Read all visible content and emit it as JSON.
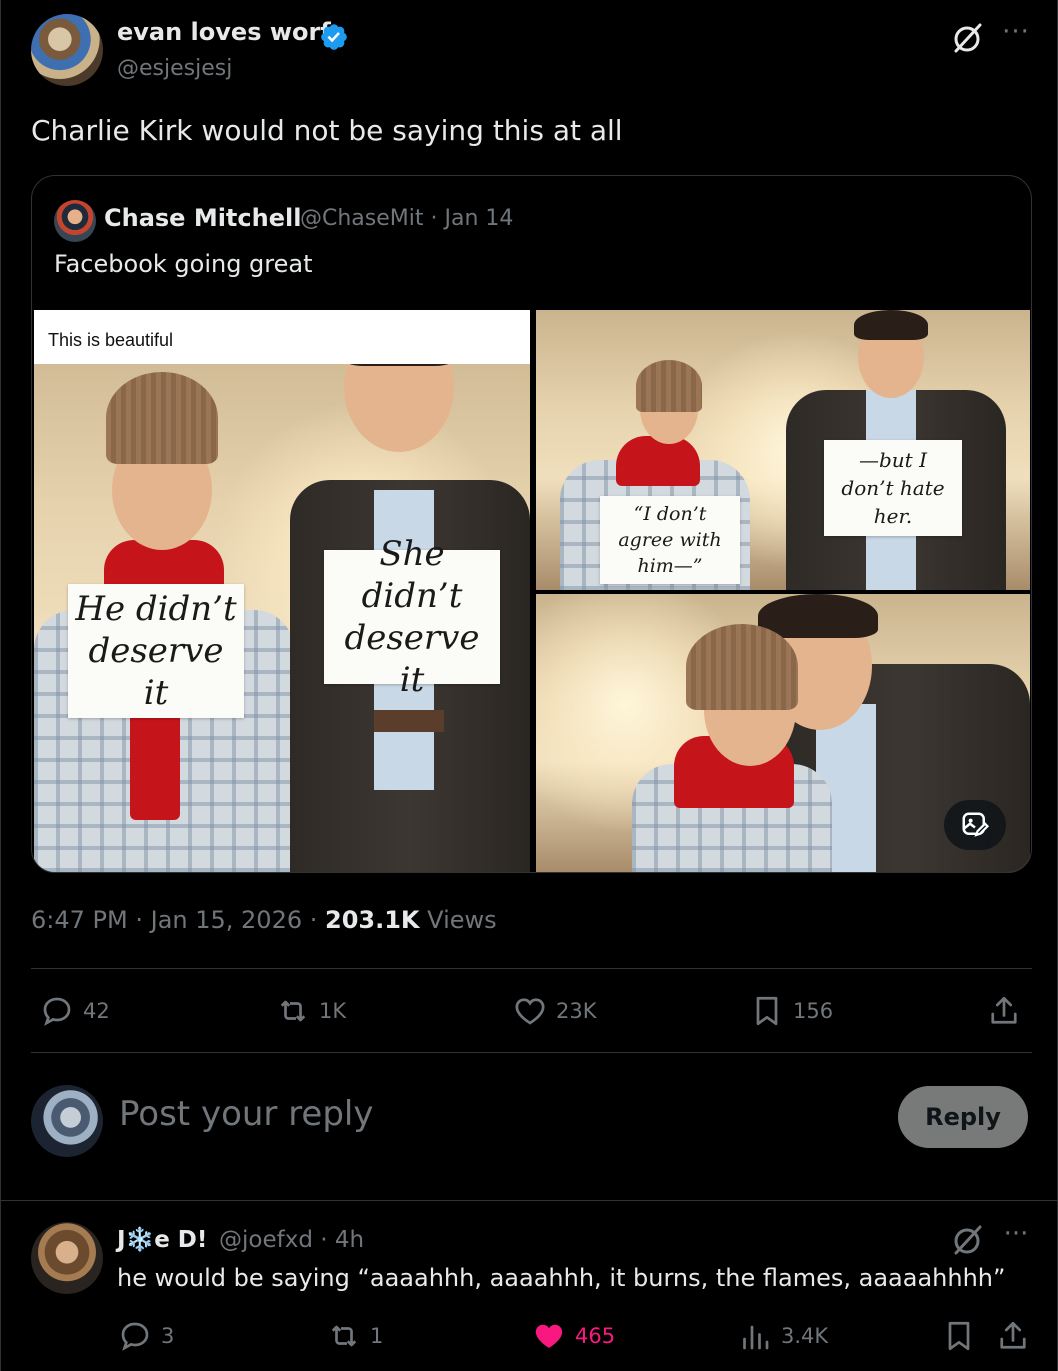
{
  "post": {
    "author_name": "evan loves worf",
    "author_handle": "@esjesjesj",
    "text": "Charlie Kirk would not be saying this at all",
    "time": "6:47 PM",
    "date": "Jan 15, 2026",
    "views_count": "203.1K",
    "views_label": "Views",
    "more_icon": "more-horizontal-icon",
    "grok_icon": "grok-icon",
    "verified_icon": "verified-badge-icon",
    "accent_color": "#1d9bf0"
  },
  "quote": {
    "author_name": "Chase Mitchell",
    "author_handle": "@ChaseMit",
    "date": "Jan 14",
    "text": "Facebook going great",
    "images": {
      "fb_caption": "This is beautiful",
      "left_sign_woman": "He didn’t deserve it",
      "left_sign_man": "She didn’t deserve it",
      "tr_sign_woman": "“I don’t agree with him—”",
      "tr_sign_man": "—but I don’t hate her.",
      "alt_icon": "image-edit-icon"
    }
  },
  "actions": {
    "replies": "42",
    "reposts": "1K",
    "likes": "23K",
    "bookmarks": "156"
  },
  "composer": {
    "placeholder": "Post your reply",
    "button_label": "Reply"
  },
  "reply": {
    "author_name_prefix": "J",
    "author_name_emoji": "❄️",
    "author_name_suffix": "e D!",
    "author_handle": "@joefxd",
    "time": "4h",
    "text": "he would be saying “aaaahhh, aaaahhh, it burns, the flames, aaaaahhhh”",
    "replies": "3",
    "reposts": "1",
    "likes": "465",
    "views": "3.4K",
    "like_color": "#f91880"
  }
}
